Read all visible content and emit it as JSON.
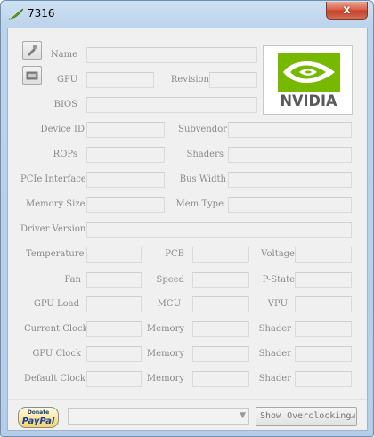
{
  "window": {
    "title": "7316",
    "close_glyph": "x",
    "app_icon": "gpuz-leaf-icon",
    "close_icon": "close-icon"
  },
  "side_buttons": [
    {
      "name": "screenshot-button",
      "icon": "camera-icon"
    },
    {
      "name": "save-bios-button",
      "icon": "chip-icon"
    }
  ],
  "logo": {
    "text": "NVIDIA",
    "eye_color": "#76b900"
  },
  "labels": {
    "name": "Name",
    "gpu": "GPU",
    "revision": "Revision",
    "bios": "BIOS",
    "device_id": "Device ID",
    "subvendor": "Subvendor",
    "rops": "ROPs",
    "shaders": "Shaders",
    "pcie_interface": "PCIe Interface",
    "bus_width": "Bus Width",
    "memory_size": "Memory Size",
    "mem_type": "Mem Type",
    "driver_version": "Driver Version",
    "temperature": "Temperature",
    "pcb": "PCB",
    "voltage": "Voltage",
    "fan": "Fan",
    "speed": "Speed",
    "p_state": "P-State",
    "gpu_load": "GPU Load",
    "mcu": "MCU",
    "vpu": "VPU",
    "current_clock": "Current Clock",
    "gpu_clock": "GPU Clock",
    "default_clock": "Default Clock",
    "memory_1": "Memory",
    "memory_2": "Memory",
    "memory_3": "Memory",
    "shader_1": "Shader",
    "shader_2": "Shader",
    "shader_3": "Shader"
  },
  "values": {
    "name": "",
    "gpu": "",
    "revision": "",
    "bios": "",
    "device_id": "",
    "subvendor": "",
    "rops": "",
    "shaders": "",
    "pcie_interface": "",
    "bus_width": "",
    "memory_size": "",
    "mem_type": "",
    "driver_version": "",
    "temperature": "",
    "pcb": "",
    "voltage": "",
    "fan": "",
    "speed": "",
    "p_state": "",
    "gpu_load": "",
    "mcu": "",
    "vpu": "",
    "current_clock": "",
    "current_memory": "",
    "current_shader": "",
    "gpu_clock": "",
    "gpu_memory": "",
    "gpu_shader": "",
    "default_clock": "",
    "default_memory": "",
    "default_shader": ""
  },
  "footer": {
    "donate_text": "Donate",
    "paypal_text": "PayPal",
    "gpu_select_value": "",
    "dropdown_icon": "chevron-down-icon",
    "overclock_button": "Show Overclocking"
  }
}
